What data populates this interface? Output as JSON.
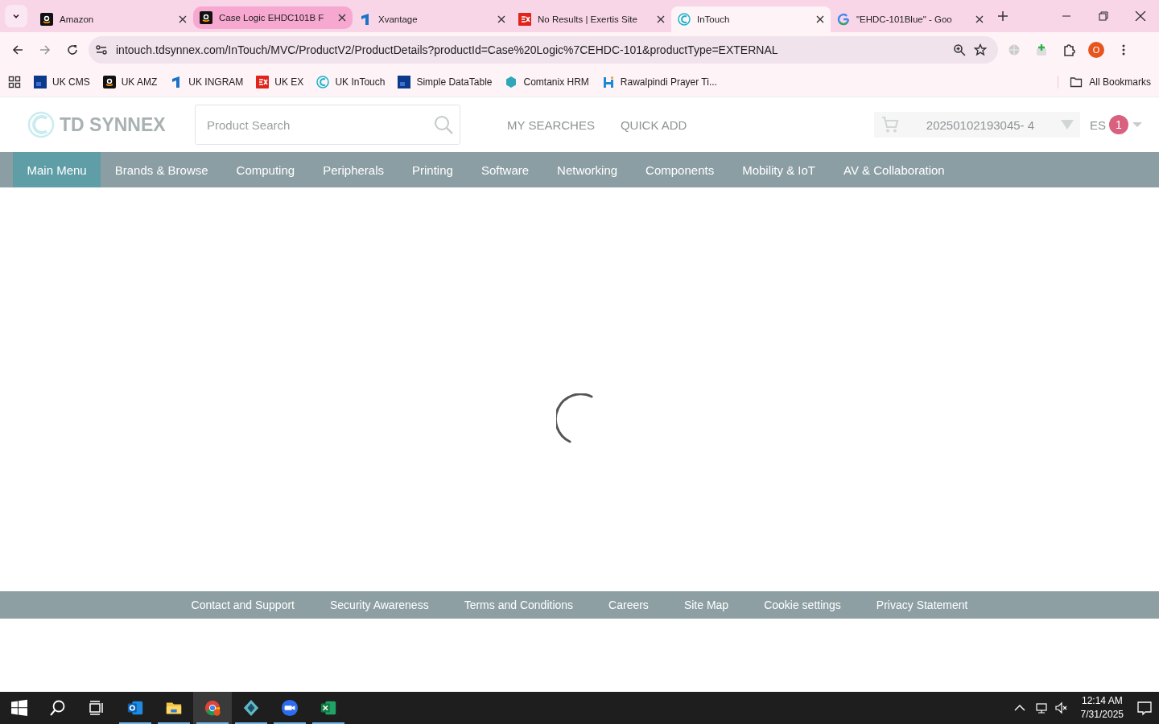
{
  "browser": {
    "tabs": [
      {
        "title": "Amazon",
        "kind": "amazon",
        "selected": false,
        "highlighted": false
      },
      {
        "title": "Case Logic EHDC101B F",
        "kind": "amazon",
        "selected": false,
        "highlighted": true
      },
      {
        "title": "Xvantage",
        "kind": "ingram",
        "selected": false,
        "highlighted": false
      },
      {
        "title": "No Results | Exertis Site",
        "kind": "exertis",
        "selected": false,
        "highlighted": false
      },
      {
        "title": "InTouch",
        "kind": "intouch",
        "selected": true,
        "highlighted": false
      },
      {
        "title": "\"EHDC-101Blue\" - Goo",
        "kind": "google",
        "selected": false,
        "highlighted": false
      }
    ],
    "address": "intouch.tdsynnex.com/InTouch/MVC/ProductV2/ProductDetails?productId=Case%20Logic%7CEHDC-101&productType=EXTERNAL",
    "profile": "O",
    "bookmarks": [
      {
        "label": "UK CMS",
        "kind": "df"
      },
      {
        "label": "UK AMZ",
        "kind": "amazon"
      },
      {
        "label": "UK INGRAM",
        "kind": "ingram"
      },
      {
        "label": "UK EX",
        "kind": "exertis"
      },
      {
        "label": "UK InTouch",
        "kind": "intouch"
      },
      {
        "label": "Simple DataTable",
        "kind": "df"
      },
      {
        "label": "Comtanix HRM",
        "kind": "comtanix"
      },
      {
        "label": "Rawalpindi Prayer Ti...",
        "kind": "rawalpindi"
      }
    ],
    "all_bookmarks": "All Bookmarks"
  },
  "site": {
    "logo": "TD SYNNEX",
    "search": {
      "placeholder": "Product Search"
    },
    "links": [
      "MY SEARCHES",
      "QUICK ADD"
    ],
    "cart": {
      "order": "20250102193045- 4"
    },
    "user": {
      "initials": "ES",
      "badge": "1"
    },
    "menu": [
      {
        "label": "Main Menu",
        "selected": true
      },
      {
        "label": "Brands & Browse",
        "selected": false
      },
      {
        "label": "Computing",
        "selected": false
      },
      {
        "label": "Peripherals",
        "selected": false
      },
      {
        "label": "Printing",
        "selected": false
      },
      {
        "label": "Software",
        "selected": false
      },
      {
        "label": "Networking",
        "selected": false
      },
      {
        "label": "Components",
        "selected": false
      },
      {
        "label": "Mobility & IoT",
        "selected": false
      },
      {
        "label": "AV & Collaboration",
        "selected": false
      }
    ],
    "footer": [
      "Contact and Support",
      "Security Awareness",
      "Terms and Conditions",
      "Careers",
      "Site Map",
      "Cookie settings",
      "Privacy Statement"
    ]
  },
  "taskbar": {
    "apps": [
      {
        "kind": "outlook",
        "active": false,
        "running": true
      },
      {
        "kind": "explorer",
        "active": false,
        "running": true
      },
      {
        "kind": "chrome",
        "active": true,
        "running": true
      },
      {
        "kind": "diamond",
        "active": false,
        "running": true
      },
      {
        "kind": "zoom",
        "active": false,
        "running": true
      },
      {
        "kind": "excel",
        "active": false,
        "running": true
      }
    ],
    "time": "12:14 AM",
    "date": "7/31/2025"
  }
}
